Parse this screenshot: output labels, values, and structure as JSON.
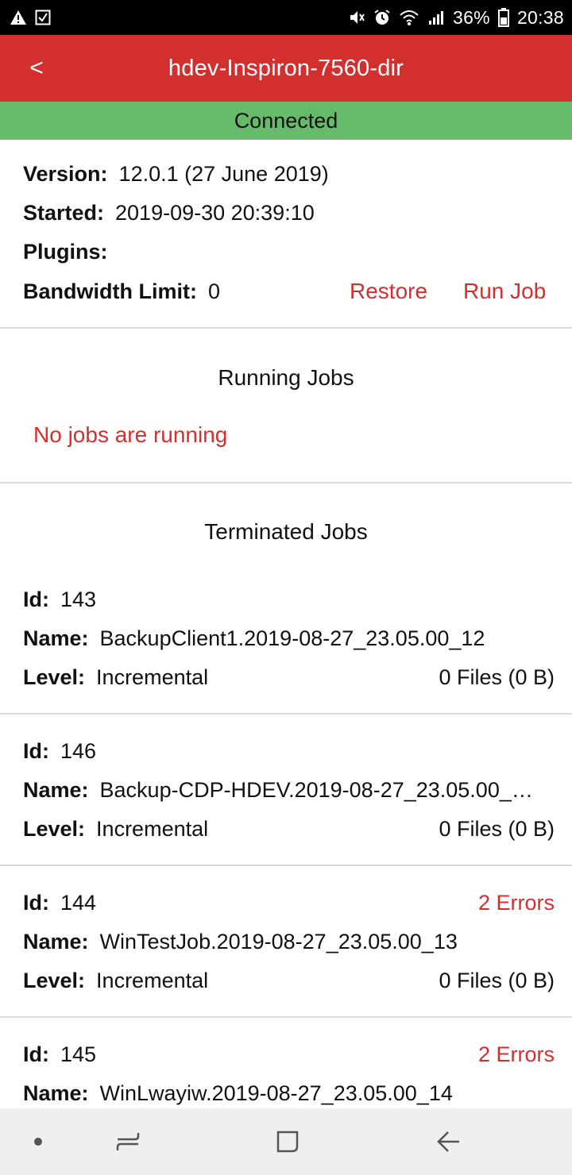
{
  "status_bar": {
    "battery": "36%",
    "time": "20:38",
    "icons": [
      "warning-icon",
      "checkbox-icon",
      "mute-icon",
      "alarm-icon",
      "wifi-icon",
      "signal-icon",
      "battery-icon"
    ]
  },
  "app_bar": {
    "back_label": "<",
    "title": "hdev-Inspiron-7560-dir",
    "color": "#d32f2f"
  },
  "connection": {
    "status": "Connected",
    "color": "#66bb6a"
  },
  "info": {
    "version_key": "Version:",
    "version_value": "12.0.1 (27 June 2019)",
    "started_key": "Started:",
    "started_value": "2019-09-30 20:39:10",
    "plugins_key": "Plugins:",
    "plugins_value": "",
    "bandwidth_key": "Bandwidth Limit:",
    "bandwidth_value": "0",
    "restore_label": "Restore",
    "run_job_label": "Run Job"
  },
  "running_jobs": {
    "title": "Running Jobs",
    "empty_message": "No jobs are running"
  },
  "terminated_jobs": {
    "title": "Terminated Jobs",
    "labels": {
      "id": "Id:",
      "name": "Name:",
      "level": "Level:"
    },
    "jobs": [
      {
        "id": "143",
        "name": "BackupClient1.2019-08-27_23.05.00_12",
        "level": "Incremental",
        "files": "0 Files (0 B)",
        "errors": ""
      },
      {
        "id": "146",
        "name": "Backup-CDP-HDEV.2019-08-27_23.05.00_…",
        "level": "Incremental",
        "files": "0 Files (0 B)",
        "errors": ""
      },
      {
        "id": "144",
        "name": "WinTestJob.2019-08-27_23.05.00_13",
        "level": "Incremental",
        "files": "0 Files (0 B)",
        "errors": "2 Errors"
      },
      {
        "id": "145",
        "name": "WinLwayiw.2019-08-27_23.05.00_14",
        "level": "",
        "files": "",
        "errors": "2 Errors"
      }
    ]
  },
  "nav_bar": {
    "buttons": [
      "dot-icon",
      "recents-icon",
      "home-icon",
      "back-arrow-icon"
    ]
  }
}
